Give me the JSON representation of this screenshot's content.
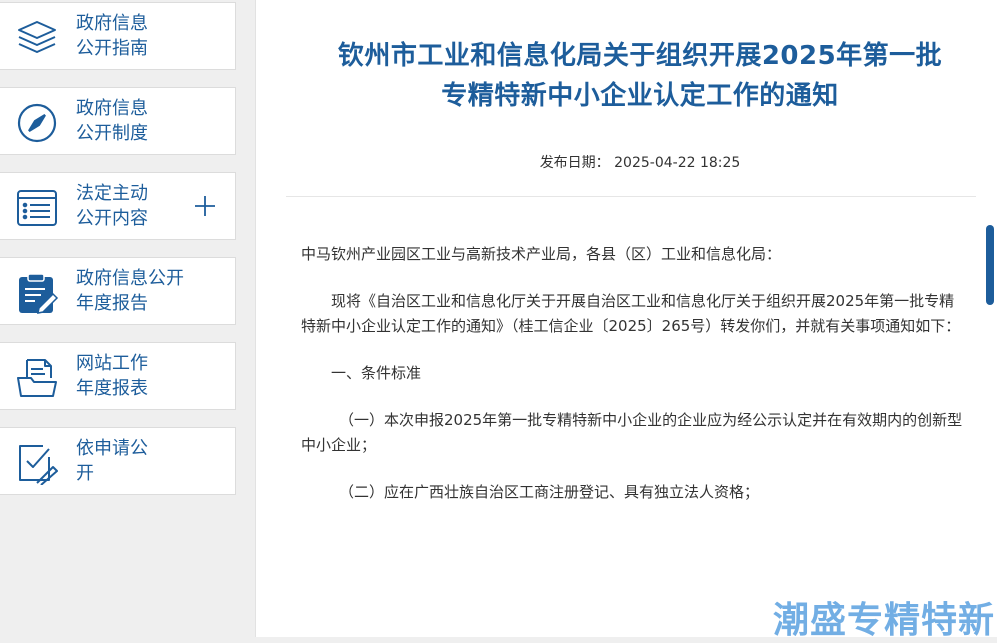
{
  "sidebar": {
    "items": [
      {
        "line1": "政府信息",
        "line2": "公开指南",
        "icon": "layers-icon"
      },
      {
        "line1": "政府信息",
        "line2": "公开制度",
        "icon": "compass-icon"
      },
      {
        "line1": "法定主动",
        "line2": "公开内容",
        "icon": "list-document-icon",
        "expand": "plus-icon"
      },
      {
        "line1": "政府信息公开",
        "line2": "年度报告",
        "icon": "clipboard-edit-icon"
      },
      {
        "line1": "网站工作",
        "line2": "年度报表",
        "icon": "folder-document-icon"
      },
      {
        "line1": "依申请公",
        "line2": "开",
        "icon": "apply-edit-icon"
      }
    ]
  },
  "article": {
    "title_line1": "钦州市工业和信息化局关于组织开展2025年第一批",
    "title_line2": "专精特新中小企业认定工作的通知",
    "date_label": "发布日期：",
    "date_value": "2025-04-22 18:25",
    "paragraphs": [
      "中马钦州产业园区工业与高新技术产业局，各县（区）工业和信息化局：",
      "现将《自治区工业和信息化厅关于开展自治区工业和信息化厅关于组织开展2025年第一批专精特新中小企业认定工作的通知》（桂工信企业〔2025〕265号）转发你们，并就有关事项通知如下：",
      "一、条件标准",
      "（一）本次申报2025年第一批专精特新中小企业的企业应为经公示认定并在有效期内的创新型中小企业；",
      "（二）应在广西壮族自治区工商注册登记、具有独立法人资格；"
    ]
  },
  "watermark": "潮盛专精特新",
  "colors": {
    "accent": "#1d5d9b",
    "watermark": "#5aa0e0",
    "background": "#efefef"
  }
}
